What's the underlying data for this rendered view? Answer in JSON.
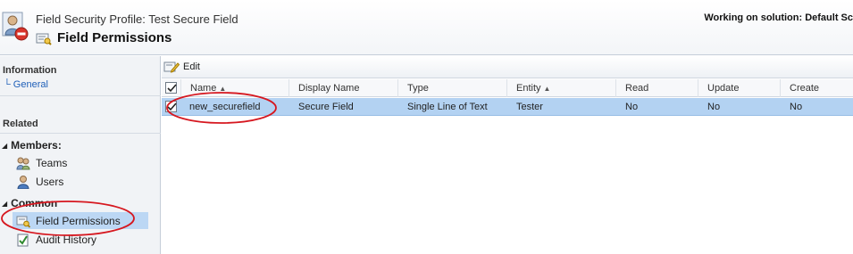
{
  "header": {
    "breadcrumb": "Field Security Profile: Test Secure Field",
    "title": "Field Permissions",
    "solution": "Working on solution: Default Sc"
  },
  "sidebar": {
    "information_title": "Information",
    "general_link": "General",
    "related_title": "Related",
    "members_group": "Members:",
    "teams": "Teams",
    "users": "Users",
    "common_group": "Common",
    "field_permissions": "Field Permissions",
    "audit_history": "Audit History"
  },
  "toolbar": {
    "edit_label": "Edit"
  },
  "grid": {
    "columns": {
      "name": "Name",
      "display_name": "Display Name",
      "type": "Type",
      "entity": "Entity",
      "read": "Read",
      "update": "Update",
      "create": "Create"
    },
    "rows": [
      {
        "name": "new_securefield",
        "display_name": "Secure Field",
        "type": "Single Line of Text",
        "entity": "Tester",
        "read": "No",
        "update": "No",
        "create": "No"
      }
    ]
  },
  "colors": {
    "selected_row": "#b3d2f2",
    "nav_selected": "#bcd7f4",
    "annotation": "#d6171f",
    "link": "#1f5fb8"
  }
}
